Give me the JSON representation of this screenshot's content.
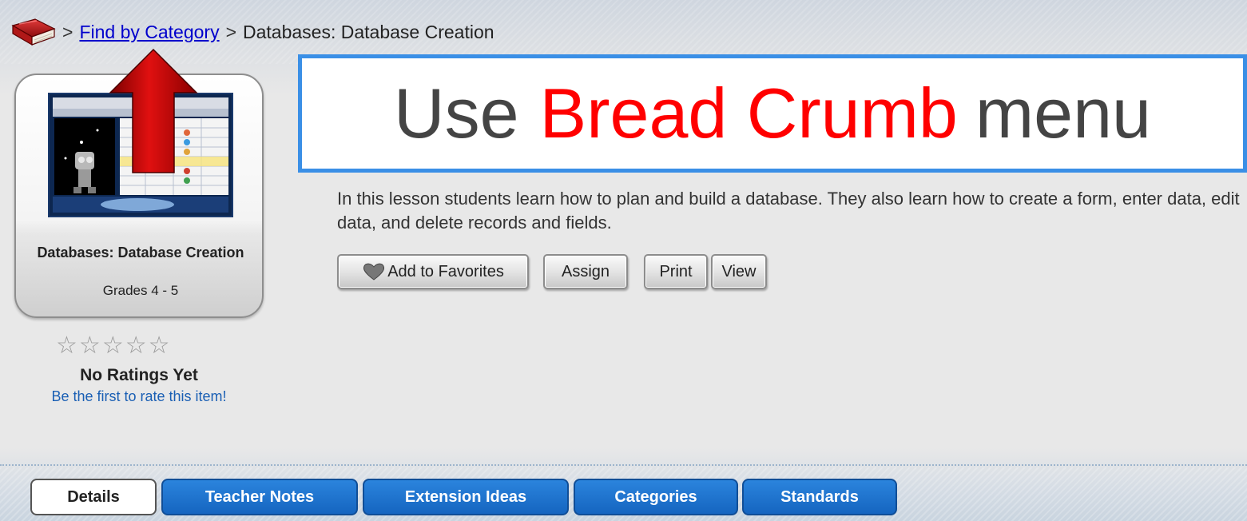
{
  "breadcrumb": {
    "separator": ">",
    "link_label": "Find by Category",
    "current": "Databases: Database Creation"
  },
  "callout": {
    "prefix": "Use",
    "highlight": "Bread Crumb",
    "suffix": "menu",
    "highlight_color": "#ff0000",
    "border_color": "#3a8fe6"
  },
  "product": {
    "title": "Databases: Database Creation",
    "grades": "Grades 4 - 5",
    "thumbnail": "lesson-screenshot-image"
  },
  "rating": {
    "stars_filled": 0,
    "stars_total": 5,
    "status": "No Ratings Yet",
    "prompt": "Be the first to rate this item!"
  },
  "description": "In this lesson students learn how to plan and build a database. They also learn how to create a form, enter data, edit data, and delete records and fields.",
  "actions": {
    "favorites_label": "Add to Favorites",
    "assign_label": "Assign",
    "print_label": "Print",
    "view_label": "View"
  },
  "tabs": [
    {
      "label": "Details",
      "active": true
    },
    {
      "label": "Teacher Notes",
      "active": false
    },
    {
      "label": "Extension Ideas",
      "active": false
    },
    {
      "label": "Categories",
      "active": false
    },
    {
      "label": "Standards",
      "active": false
    }
  ],
  "icons": {
    "breadcrumb_home": "book-icon",
    "favorites": "heart-icon",
    "annotation": "red-arrow-up-icon",
    "rating": "star-icon"
  },
  "colors": {
    "tab_active_bg": "#ffffff",
    "tab_inactive_bg": "#1f6fcb",
    "link": "#0000cc",
    "arrow": "#cc0000"
  }
}
